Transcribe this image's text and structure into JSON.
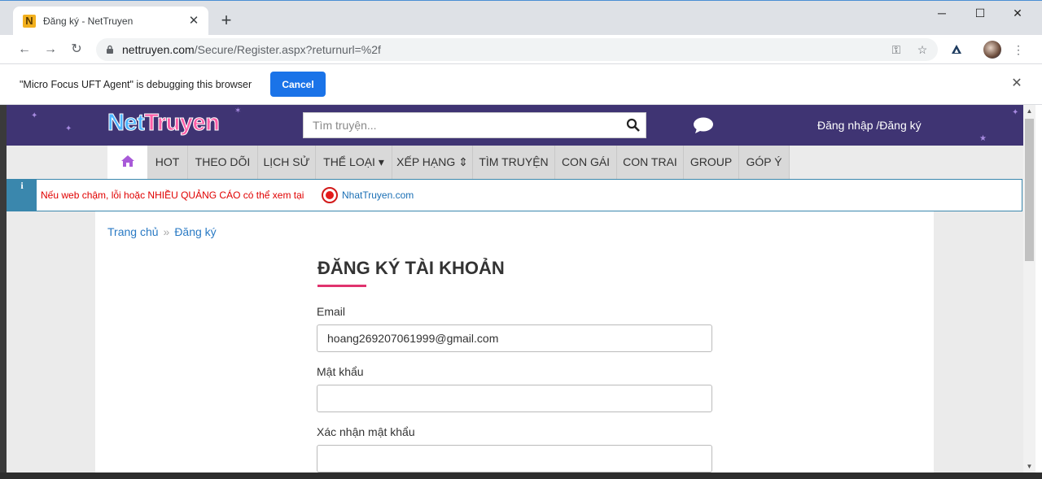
{
  "browser": {
    "tab_title": "Đăng ký - NetTruyen",
    "tab_favicon_letter": "N",
    "url_host": "nettruyen.com",
    "url_path": "/Secure/Register.aspx?returnurl=%2f",
    "infobar_message": "\"Micro Focus UFT Agent\" is debugging this browser",
    "infobar_cancel": "Cancel"
  },
  "site": {
    "logo_part1": "Net",
    "logo_part2": "Truyen",
    "search_placeholder": "Tìm truyện...",
    "login_register": "Đăng nhập /Đăng ký",
    "nav": [
      "HOT",
      "THEO DÕI",
      "LỊCH SỬ",
      "THỂ LOẠI ▾",
      "XẾP HẠNG ⇕",
      "TÌM TRUYỆN",
      "CON GÁI",
      "CON TRAI",
      "GROUP",
      "GÓP Ý"
    ],
    "notice_text": "Nếu web chậm, lỗi hoặc NHIỀU QUẢNG CÁO có thể xem tại",
    "notice_link": "NhatTruyen.com"
  },
  "breadcrumb": {
    "home": "Trang chủ",
    "separator": "»",
    "current": "Đăng ký"
  },
  "form": {
    "title": "ĐĂNG KÝ TÀI KHOẢN",
    "email_label": "Email",
    "email_value": "hoang269207061999@gmail.com",
    "password_label": "Mật khẩu",
    "confirm_label": "Xác nhận mật khẩu"
  },
  "colors": {
    "header_bg": "#3f3473",
    "accent_underline": "#e0336e",
    "info_blue": "#3a87ad",
    "chrome_button": "#1a73e8"
  }
}
